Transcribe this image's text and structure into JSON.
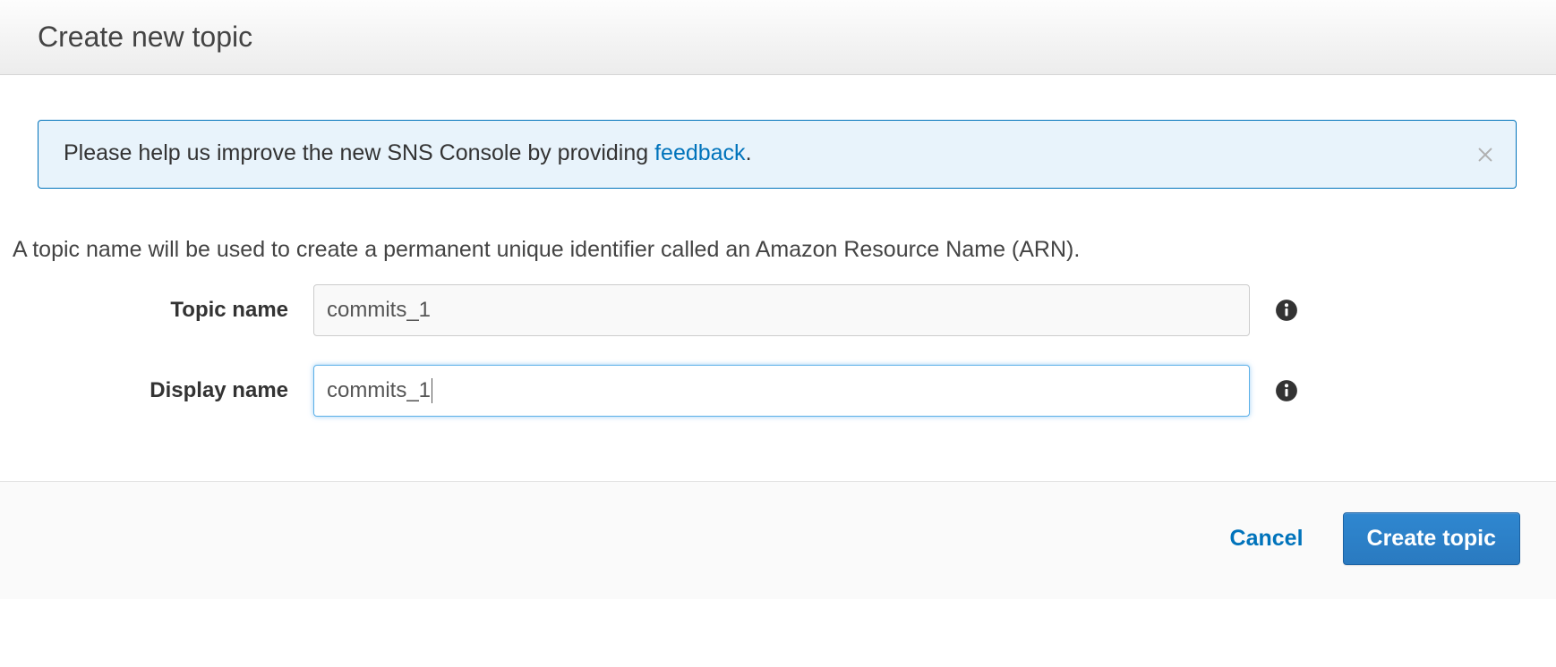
{
  "header": {
    "title": "Create new topic"
  },
  "banner": {
    "text_before": "Please help us improve the new SNS Console by providing ",
    "link_text": "feedback",
    "text_after": "."
  },
  "description": "A topic name will be used to create a permanent unique identifier called an Amazon Resource Name (ARN).",
  "form": {
    "topic_name": {
      "label": "Topic name",
      "value": "commits_1"
    },
    "display_name": {
      "label": "Display name",
      "value": "commits_1"
    }
  },
  "footer": {
    "cancel": "Cancel",
    "create": "Create topic"
  }
}
